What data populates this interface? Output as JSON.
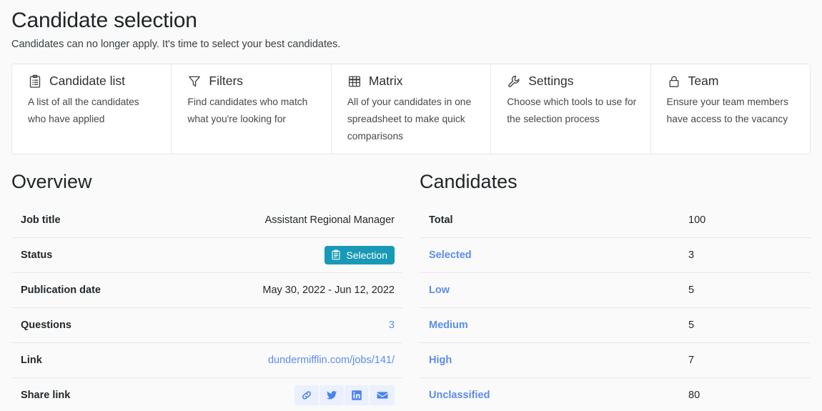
{
  "header": {
    "title": "Candidate selection",
    "subtitle": "Candidates can no longer apply. It's time to select your best candidates."
  },
  "tool_cards": [
    {
      "icon": "clipboard-list-icon",
      "title": "Candidate list",
      "description": "A list of all the candidates who have applied"
    },
    {
      "icon": "funnel-icon",
      "title": "Filters",
      "description": "Find candidates who match what you're looking for"
    },
    {
      "icon": "grid-table-icon",
      "title": "Matrix",
      "description": "All of your candidates in one spreadsheet to make quick comparisons"
    },
    {
      "icon": "wrench-icon",
      "title": "Settings",
      "description": "Choose which tools to use for the selection process"
    },
    {
      "icon": "lock-icon",
      "title": "Team",
      "description": "Ensure your team members have access to the vacancy"
    }
  ],
  "overview": {
    "title": "Overview",
    "rows": [
      {
        "label": "Job title",
        "value": "Assistant Regional Manager",
        "type": "text"
      },
      {
        "label": "Status",
        "value": "Selection",
        "type": "badge"
      },
      {
        "label": "Publication date",
        "value": "May 30, 2022 - Jun 12, 2022",
        "type": "text"
      },
      {
        "label": "Questions",
        "value": "3",
        "type": "link"
      },
      {
        "label": "Link",
        "value": "dundermifflin.com/jobs/141/",
        "type": "link"
      },
      {
        "label": "Share link",
        "value": "",
        "type": "share"
      }
    ],
    "share_buttons": [
      {
        "icon": "chain-link-icon",
        "label": "Copy link"
      },
      {
        "icon": "twitter-icon",
        "label": "Share on Twitter"
      },
      {
        "icon": "linkedin-icon",
        "label": "Share on LinkedIn"
      },
      {
        "icon": "email-icon",
        "label": "Share by email"
      }
    ]
  },
  "candidates": {
    "title": "Candidates",
    "rows": [
      {
        "label": "Total",
        "value": "100",
        "is_link": false
      },
      {
        "label": "Selected",
        "value": "3",
        "is_link": true
      },
      {
        "label": "Low",
        "value": "5",
        "is_link": true
      },
      {
        "label": "Medium",
        "value": "5",
        "is_link": true
      },
      {
        "label": "High",
        "value": "7",
        "is_link": true
      },
      {
        "label": "Unclassified",
        "value": "80",
        "is_link": true
      }
    ]
  },
  "colors": {
    "page_background": "#fafafa",
    "badge_teal": "#1899b5",
    "link_blue": "#5b8def",
    "share_button_background": "#eaf0fd",
    "border": "#e3e5ea",
    "text": "#22282c"
  }
}
